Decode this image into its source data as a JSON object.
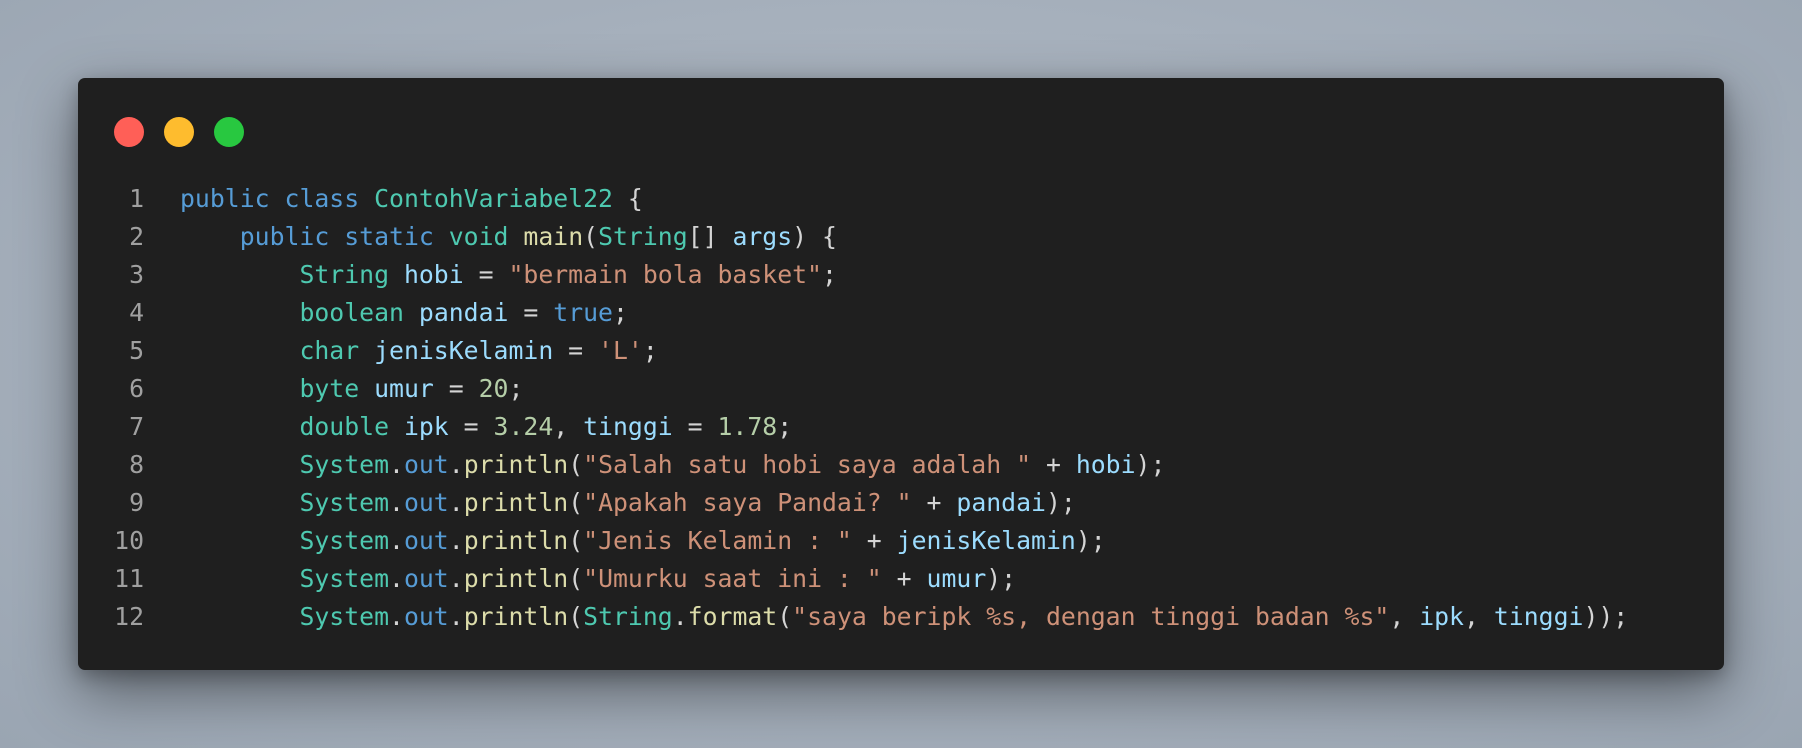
{
  "window": {
    "title_dots": [
      "close",
      "minimize",
      "maximize"
    ],
    "colors": {
      "background": "#1f1f1f",
      "keyword": "#569cd6",
      "type": "#4ec9b0",
      "function": "#dcdcaa",
      "string": "#ce9178",
      "number": "#b5cea8",
      "variable": "#9cdcfe",
      "punctuation": "#d4d4d4"
    }
  },
  "code": {
    "lines": [
      {
        "number": "1",
        "tokens": [
          [
            "kw",
            "public"
          ],
          [
            "pu",
            " "
          ],
          [
            "kw",
            "class"
          ],
          [
            "pu",
            " "
          ],
          [
            "ty",
            "ContohVariabel22"
          ],
          [
            "pu",
            " {"
          ]
        ]
      },
      {
        "number": "2",
        "tokens": [
          [
            "pu",
            "    "
          ],
          [
            "kw",
            "public"
          ],
          [
            "pu",
            " "
          ],
          [
            "kw",
            "static"
          ],
          [
            "pu",
            " "
          ],
          [
            "ty",
            "void"
          ],
          [
            "pu",
            " "
          ],
          [
            "fn",
            "main"
          ],
          [
            "pu",
            "("
          ],
          [
            "ty",
            "String"
          ],
          [
            "pu",
            "[] "
          ],
          [
            "va",
            "args"
          ],
          [
            "pu",
            ") {"
          ]
        ]
      },
      {
        "number": "3",
        "tokens": [
          [
            "pu",
            "        "
          ],
          [
            "ty",
            "String"
          ],
          [
            "pu",
            " "
          ],
          [
            "va",
            "hobi"
          ],
          [
            "pu",
            " = "
          ],
          [
            "st",
            "\"bermain bola basket\""
          ],
          [
            "pu",
            ";"
          ]
        ]
      },
      {
        "number": "4",
        "tokens": [
          [
            "pu",
            "        "
          ],
          [
            "ty",
            "boolean"
          ],
          [
            "pu",
            " "
          ],
          [
            "va",
            "pandai"
          ],
          [
            "pu",
            " = "
          ],
          [
            "kw",
            "true"
          ],
          [
            "pu",
            ";"
          ]
        ]
      },
      {
        "number": "5",
        "tokens": [
          [
            "pu",
            "        "
          ],
          [
            "ty",
            "char"
          ],
          [
            "pu",
            " "
          ],
          [
            "va",
            "jenisKelamin"
          ],
          [
            "pu",
            " = "
          ],
          [
            "st",
            "'L'"
          ],
          [
            "pu",
            ";"
          ]
        ]
      },
      {
        "number": "6",
        "tokens": [
          [
            "pu",
            "        "
          ],
          [
            "ty",
            "byte"
          ],
          [
            "pu",
            " "
          ],
          [
            "va",
            "umur"
          ],
          [
            "pu",
            " = "
          ],
          [
            "nu",
            "20"
          ],
          [
            "pu",
            ";"
          ]
        ]
      },
      {
        "number": "7",
        "tokens": [
          [
            "pu",
            "        "
          ],
          [
            "ty",
            "double"
          ],
          [
            "pu",
            " "
          ],
          [
            "va",
            "ipk"
          ],
          [
            "pu",
            " = "
          ],
          [
            "nu",
            "3.24"
          ],
          [
            "pu",
            ", "
          ],
          [
            "va",
            "tinggi"
          ],
          [
            "pu",
            " = "
          ],
          [
            "nu",
            "1.78"
          ],
          [
            "pu",
            ";"
          ]
        ]
      },
      {
        "number": "8",
        "tokens": [
          [
            "pu",
            "        "
          ],
          [
            "ty",
            "System"
          ],
          [
            "pu",
            "."
          ],
          [
            "kw",
            "out"
          ],
          [
            "pu",
            "."
          ],
          [
            "fn",
            "println"
          ],
          [
            "pu",
            "("
          ],
          [
            "st",
            "\"Salah satu hobi saya adalah \""
          ],
          [
            "pu",
            " + "
          ],
          [
            "va",
            "hobi"
          ],
          [
            "pu",
            ");"
          ]
        ]
      },
      {
        "number": "9",
        "tokens": [
          [
            "pu",
            "        "
          ],
          [
            "ty",
            "System"
          ],
          [
            "pu",
            "."
          ],
          [
            "kw",
            "out"
          ],
          [
            "pu",
            "."
          ],
          [
            "fn",
            "println"
          ],
          [
            "pu",
            "("
          ],
          [
            "st",
            "\"Apakah saya Pandai? \""
          ],
          [
            "pu",
            " + "
          ],
          [
            "va",
            "pandai"
          ],
          [
            "pu",
            ");"
          ]
        ]
      },
      {
        "number": "10",
        "tokens": [
          [
            "pu",
            "        "
          ],
          [
            "ty",
            "System"
          ],
          [
            "pu",
            "."
          ],
          [
            "kw",
            "out"
          ],
          [
            "pu",
            "."
          ],
          [
            "fn",
            "println"
          ],
          [
            "pu",
            "("
          ],
          [
            "st",
            "\"Jenis Kelamin : \""
          ],
          [
            "pu",
            " + "
          ],
          [
            "va",
            "jenisKelamin"
          ],
          [
            "pu",
            ");"
          ]
        ]
      },
      {
        "number": "11",
        "tokens": [
          [
            "pu",
            "        "
          ],
          [
            "ty",
            "System"
          ],
          [
            "pu",
            "."
          ],
          [
            "kw",
            "out"
          ],
          [
            "pu",
            "."
          ],
          [
            "fn",
            "println"
          ],
          [
            "pu",
            "("
          ],
          [
            "st",
            "\"Umurku saat ini : \""
          ],
          [
            "pu",
            " + "
          ],
          [
            "va",
            "umur"
          ],
          [
            "pu",
            ");"
          ]
        ]
      },
      {
        "number": "12",
        "tokens": [
          [
            "pu",
            "        "
          ],
          [
            "ty",
            "System"
          ],
          [
            "pu",
            "."
          ],
          [
            "kw",
            "out"
          ],
          [
            "pu",
            "."
          ],
          [
            "fn",
            "println"
          ],
          [
            "pu",
            "("
          ],
          [
            "ty",
            "String"
          ],
          [
            "pu",
            "."
          ],
          [
            "fn",
            "format"
          ],
          [
            "pu",
            "("
          ],
          [
            "st",
            "\"saya beripk %s, dengan tinggi badan %s\""
          ],
          [
            "pu",
            ", "
          ],
          [
            "va",
            "ipk"
          ],
          [
            "pu",
            ", "
          ],
          [
            "va",
            "tinggi"
          ],
          [
            "pu",
            "));"
          ]
        ]
      }
    ]
  }
}
